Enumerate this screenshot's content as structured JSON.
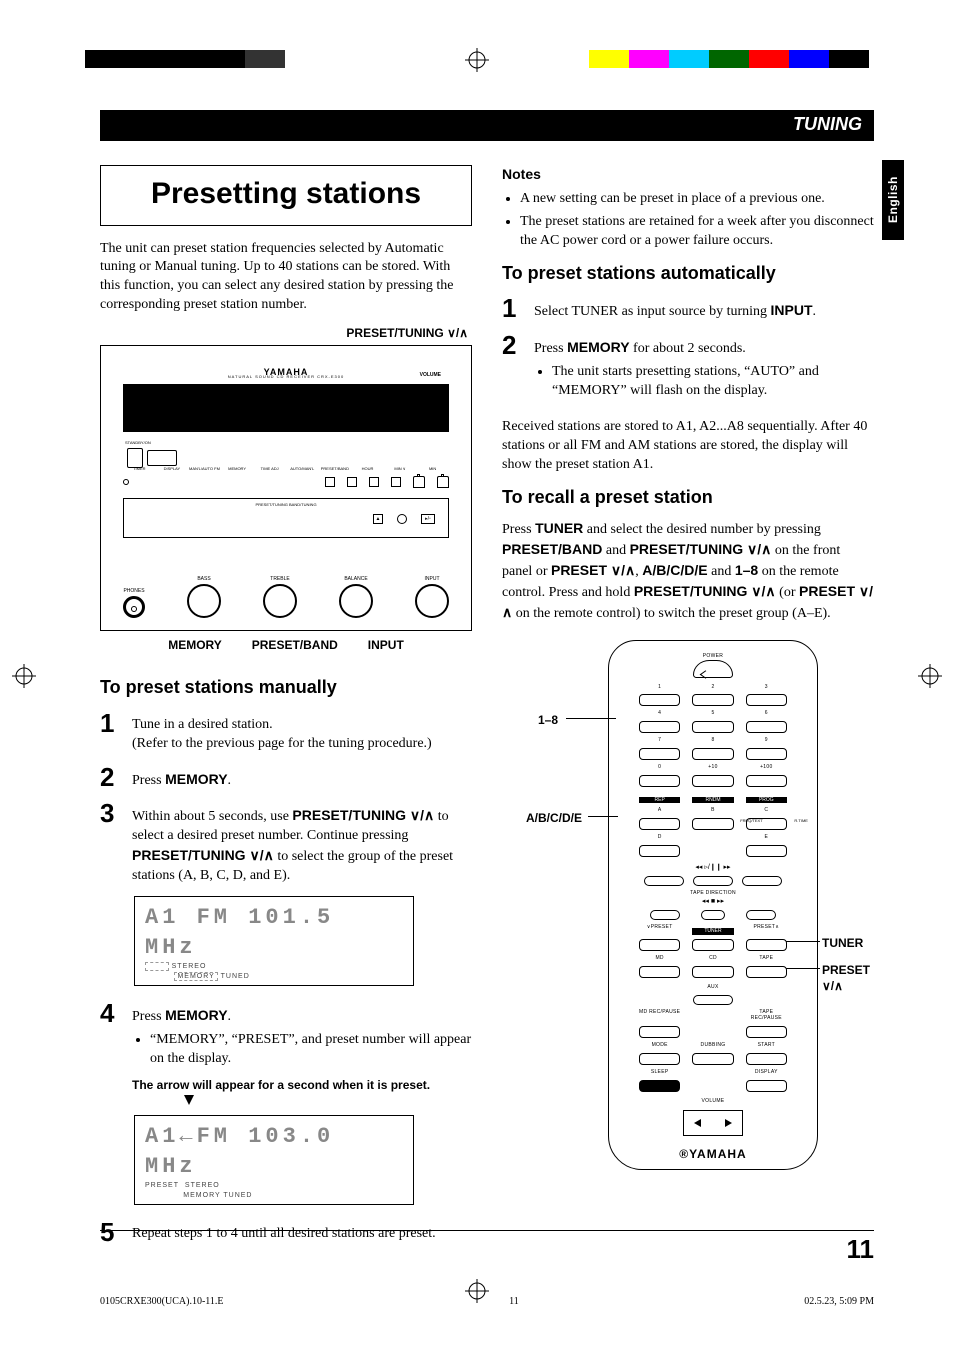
{
  "meta": {
    "section_tab": "TUNING",
    "language_tab": "English",
    "page_number": "11",
    "footer_left": "0105CRXE300(UCA).10-11.E",
    "footer_center": "11",
    "footer_right": "02.5.23, 5:09 PM"
  },
  "left": {
    "title": "Presetting stations",
    "intro": "The unit can preset station frequencies selected by Automatic tuning or Manual tuning. Up to 40 stations can be stored. With this function, you can select any desired station by pressing the corresponding preset station number.",
    "preset_tuning_label": "PRESET/TUNING ∨/∧",
    "device": {
      "brand": "YAMAHA",
      "subtitle": "NATURAL SOUND CD RECEIVER  CRX-E300",
      "volume_label": "VOLUME",
      "standby": "STANDBY/ON",
      "row1": [
        "TIMER",
        "DISPLAY",
        "MAN'L/AUTO FM",
        "MEMORY",
        "TIME ADJ",
        "AUTO/MAN'L",
        "PRESET/BAND",
        "HOUR",
        "MIN  ∨",
        "MIN",
        "MAX  ∧"
      ],
      "tray_label": "PRESET/TUNING  BAND/TUNING",
      "knobs": [
        "PHONES",
        "BASS",
        "TREBLE",
        "BALANCE",
        "INPUT"
      ]
    },
    "bottom_labels": {
      "a": "MEMORY",
      "b": "PRESET/BAND",
      "c": "INPUT"
    },
    "h_manual": "To preset stations manually",
    "step1a": "Tune in a desired station.",
    "step1b": "(Refer to the previous page for the tuning procedure.)",
    "step2_pre": "Press ",
    "step2_b": "MEMORY",
    "step2_post": ".",
    "step3_a": "Within about 5 seconds, use ",
    "step3_b1": "PRESET/TUNING ∨/∧",
    "step3_b": " to select a desired preset number. Continue pressing ",
    "step3_b2": "PRESET/TUNING ∨/∧",
    "step3_c": " to select the group of the preset stations (A, B, C, D, and E).",
    "lcd1_main": "A1  FM  101.5  MHz",
    "lcd1_sub_a": "STEREO",
    "lcd1_sub_b": "MEMORY",
    "lcd1_sub_c": "TUNED",
    "step4_pre": "Press ",
    "step4_b": "MEMORY",
    "step4_post": ".",
    "step4_li": "“MEMORY”, “PRESET”, and preset number will appear on the display.",
    "arrow_note": "The arrow will appear for a second when it is preset.",
    "lcd2_main": "A1←FM  103.0  MHz",
    "lcd2_sub_a": "PRESET",
    "lcd2_sub_b": "STEREO",
    "lcd2_sub_c": "MEMORY  TUNED",
    "step5": "Repeat steps 1 to 4 until all desired stations are preset."
  },
  "right": {
    "notes_heading": "Notes",
    "note1": "A new setting can be preset in place of a previous one.",
    "note2": "The preset stations are retained for a week after you disconnect the AC power cord or a power failure occurs.",
    "h_auto": "To preset stations automatically",
    "auto1_a": "Select TUNER as input source by turning ",
    "auto1_b": "INPUT",
    "auto1_c": ".",
    "auto2_a": "Press ",
    "auto2_b": "MEMORY",
    "auto2_c": " for about 2 seconds.",
    "auto2_li": "The unit starts presetting stations, “AUTO” and “MEMORY” will flash on the display.",
    "para": "Received stations are stored to A1, A2...A8 sequentially. After 40 stations or all FM and AM stations are stored, the display will show the preset station A1.",
    "h_recall": "To recall a preset station",
    "recall_a": "Press ",
    "recall_b1": "TUNER",
    "recall_b": " and select the desired number by pressing ",
    "recall_b2": "PRESET/BAND",
    "recall_c": " and ",
    "recall_b3": "PRESET/TUNING ∨/∧",
    "recall_d": " on the front panel or ",
    "recall_b4": "PRESET ∨/∧",
    "recall_e": ", ",
    "recall_b5": "A/B/C/D/E",
    "recall_f": " and ",
    "recall_b6": "1–8",
    "recall_g": " on the remote control. Press and hold ",
    "recall_b7": "PRESET/TUNING ∨/∧",
    "recall_h": " (or ",
    "recall_b8": "PRESET ∨/∧",
    "recall_i": " on the remote control) to switch the preset group (A–E).",
    "remote": {
      "power": "POWER",
      "nums_row1": [
        "1",
        "2",
        "3"
      ],
      "nums_row2": [
        "4",
        "5",
        "6"
      ],
      "nums_row3": [
        "7",
        "8",
        "9"
      ],
      "nums_row4": [
        "0",
        "+10",
        "+100"
      ],
      "rep_row": [
        "REP",
        "RNDM",
        "PROG"
      ],
      "abc_row1": [
        "A",
        "B",
        "C"
      ],
      "abc_row2_a": "D",
      "abc_row2_b": "FREQ/TEXT",
      "abc_row2_c": "E",
      "abc_row2_d": "R.TIME",
      "transport": "◂◂  ▹/❙❙  ▸▸",
      "tape_dir": "TAPE DIRECTION",
      "skrow": "◂◂  ■  ▸▸",
      "preset_l": "∨PRESET",
      "tuner": "TUNER",
      "preset_r": "PRESET∧",
      "src_row": [
        "MD",
        "CD",
        "TAPE"
      ],
      "aux": "AUX",
      "rec_row": [
        "MD REC/PAUSE",
        "",
        "TAPE REC/PAUSE"
      ],
      "mode_row": [
        "MODE",
        "DUBBING",
        "START"
      ],
      "sleep_row": [
        "SLEEP",
        "",
        "DISPLAY"
      ],
      "volume": "VOLUME",
      "brand": "YAMAHA"
    },
    "callouts": {
      "c1": "1–8",
      "c2": "A/B/C/D/E",
      "c3": "TUNER",
      "c4": "PRESET ∨/∧"
    }
  }
}
